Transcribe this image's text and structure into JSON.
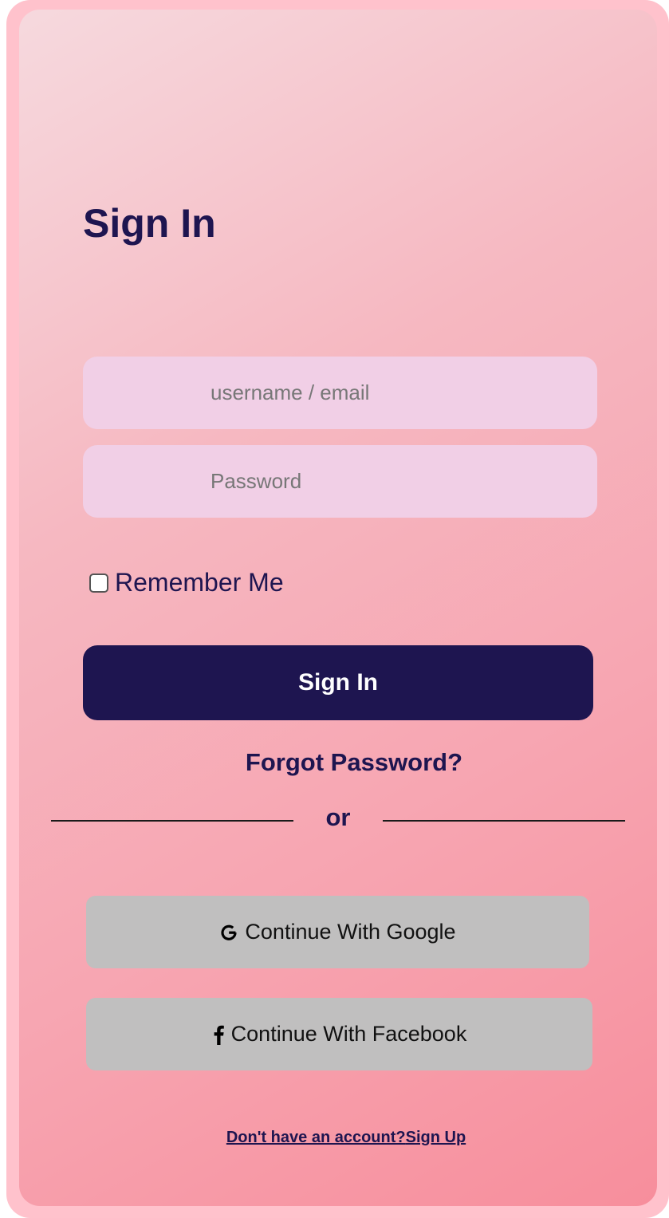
{
  "form": {
    "title": "Sign In",
    "username_placeholder": "username / email",
    "password_placeholder": "Password",
    "remember_label": "Remember Me",
    "remember_checked": false,
    "submit_label": "Sign In",
    "forgot_label": "Forgot Password?",
    "divider_label": "or"
  },
  "social": {
    "google_label": "Continue With Google",
    "google_icon": "google-icon",
    "facebook_label": "Continue With Facebook",
    "facebook_icon": "facebook-icon"
  },
  "footer": {
    "prompt": "Don't have an account?",
    "signup_label": "Sign Up"
  },
  "colors": {
    "frame": "#ffc2cc",
    "primary": "#1e1550",
    "input_bg": "#f1cfe6",
    "social_bg": "#c0bfbf"
  }
}
